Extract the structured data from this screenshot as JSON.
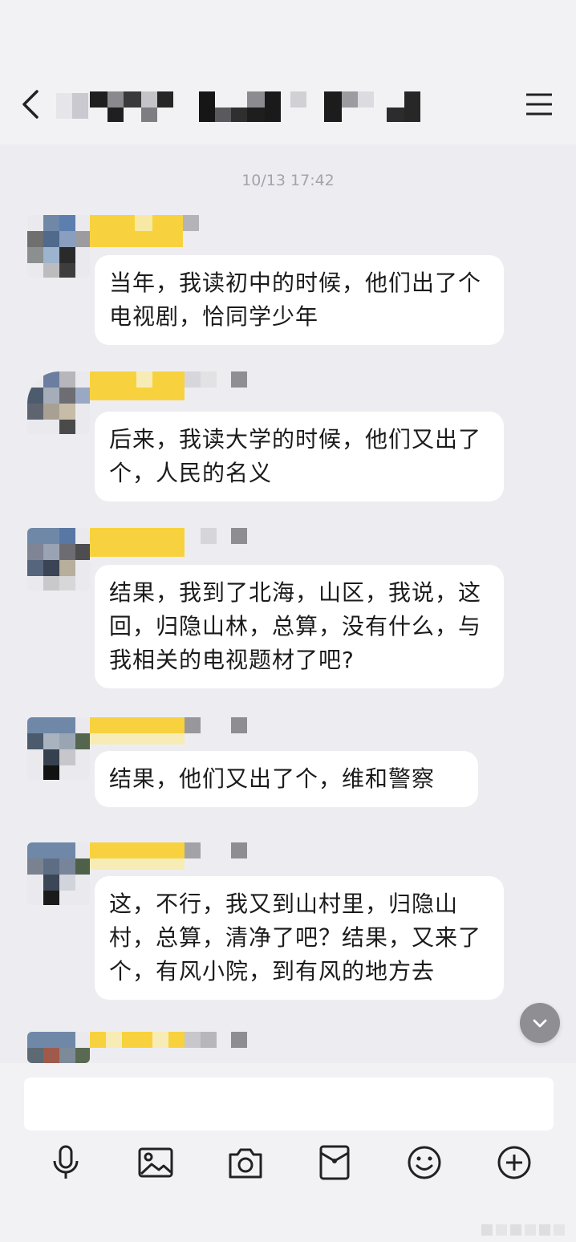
{
  "chat": {
    "timestamp": "10/13 17:42",
    "messages": [
      {
        "text": "当年，我读初中的时候，他们出了个电视剧，恰同学少年"
      },
      {
        "text": "后来，我读大学的时候，他们又出了个，人民的名义"
      },
      {
        "text": "结果，我到了北海，山区，我说，这回，归隐山林，总算，没有什么，与 我相关的电视题材了吧?"
      },
      {
        "text": "结果，他们又出了个，维和警察"
      },
      {
        "text": "这，不行，我又到山村里，归隐山村，总算，清净了吧？结果，又来了个，有风小院，到有风的地方去"
      }
    ]
  },
  "icons": {
    "back": "chevron-left-icon",
    "menu": "hamburger-menu-icon",
    "scroll": "chevron-down-icon",
    "toolbar": [
      "microphone-icon",
      "image-icon",
      "camera-icon",
      "red-packet-icon",
      "emoji-icon",
      "plus-icon"
    ]
  },
  "colors": {
    "background": "#ededf1",
    "bubble": "#ffffff",
    "name_highlight": "#f8d23e"
  }
}
